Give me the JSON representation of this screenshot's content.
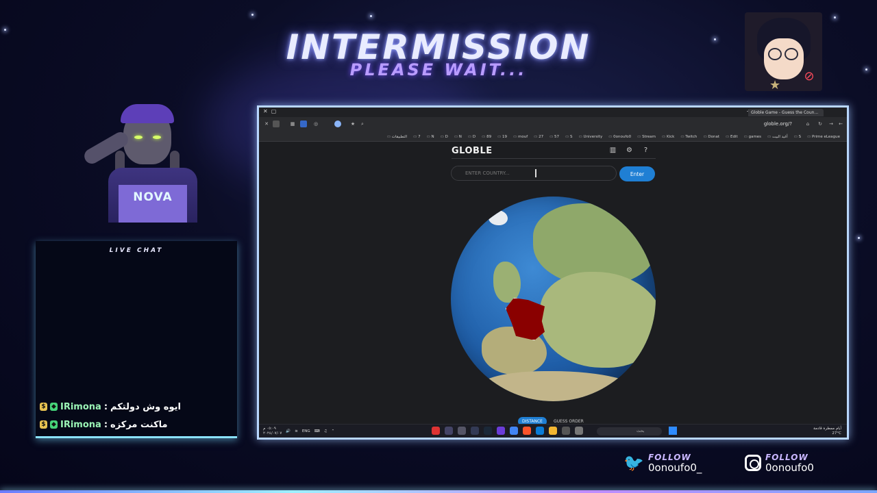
{
  "overlay": {
    "title": "INTERMISSION",
    "subtitle": "PLEASE WAIT...",
    "avatar_label": "NOVA",
    "chat": {
      "title": "LIVE CHAT",
      "messages": [
        {
          "user": "IRimona",
          "text": "ايوه وش دولتكم"
        },
        {
          "user": "IRimona",
          "text": "ماكنت مركزه"
        }
      ]
    },
    "socials": [
      {
        "platform": "twitter",
        "follow": "FOLLOW",
        "handle": "0onoufo0_"
      },
      {
        "platform": "instagram",
        "follow": "FOLLOW",
        "handle": "0onoufo0"
      }
    ]
  },
  "browser": {
    "tab_title": "Globle Game - Guess the Coun...",
    "url": "globle.org/?",
    "bookmarks": [
      "التطبيقات",
      "7",
      "N",
      "D",
      "N",
      "D",
      "89",
      "19",
      "mouf",
      "27",
      "57",
      "S",
      "University",
      "0onoufo0",
      "Stream",
      "Kick",
      "Twitch",
      "Donat",
      "Edit",
      "games",
      "أغيد البيت",
      "S",
      "Prime eLeague"
    ],
    "page": {
      "title": "GLOBLE",
      "input_placeholder": "ENTER COUNTRY...",
      "enter_label": "Enter",
      "tabs": [
        "DISTANCE",
        "GUESS ORDER"
      ],
      "highlighted_country": "France"
    },
    "taskbar": {
      "lang": "ENG",
      "time": "٠٥:٠٩ م",
      "date": "٢٠٢٤/٠٧/٠٧",
      "search_placeholder": "بحث",
      "weather_text": "أيام ممطرة قادمة",
      "temperature": "27°C"
    }
  },
  "colors": {
    "accent": "#1f7fd4",
    "highlight_country": "#8a0000",
    "frame_border": "#b9d7ff"
  }
}
